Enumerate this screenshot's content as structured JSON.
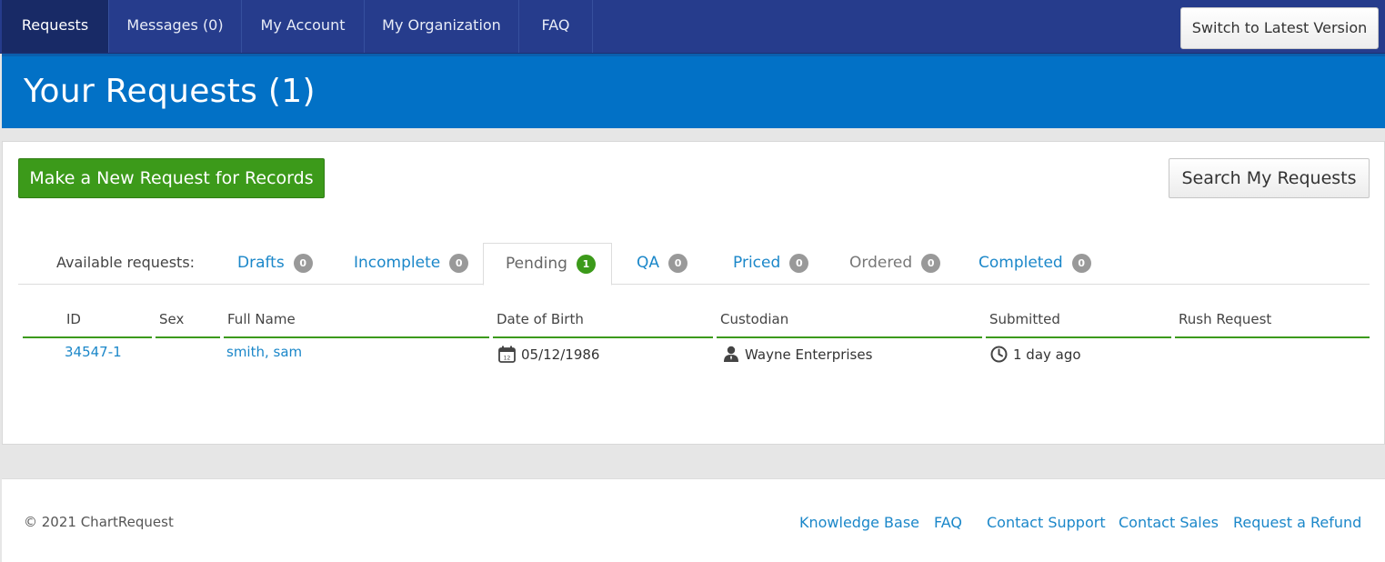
{
  "nav": {
    "items": [
      {
        "label": "Requests"
      },
      {
        "label": "Messages (0)"
      },
      {
        "label": "My Account"
      },
      {
        "label": "My Organization"
      },
      {
        "label": "FAQ"
      }
    ],
    "switch_label": "Switch to Latest Version"
  },
  "banner": {
    "title": "Your Requests (1)"
  },
  "actions": {
    "new_request": "Make a New Request for Records",
    "search": "Search My Requests"
  },
  "tabs": {
    "label": "Available requests:",
    "items": [
      {
        "label": "Drafts",
        "count": "0"
      },
      {
        "label": "Incomplete",
        "count": "0"
      },
      {
        "label": "Pending",
        "count": "1"
      },
      {
        "label": "QA",
        "count": "0"
      },
      {
        "label": "Priced",
        "count": "0"
      },
      {
        "label": "Ordered",
        "count": "0"
      },
      {
        "label": "Completed",
        "count": "0"
      }
    ]
  },
  "table": {
    "headers": [
      "ID",
      "Sex",
      "Full Name",
      "Date of Birth",
      "Custodian",
      "Submitted",
      "Rush Request"
    ],
    "rows": [
      {
        "id": "34547-1",
        "sex": "",
        "full_name": "smith, sam",
        "dob": "05/12/1986",
        "custodian": "Wayne Enterprises",
        "submitted": "1 day ago",
        "rush": ""
      }
    ]
  },
  "footer": {
    "copyright": "© 2021 ChartRequest",
    "links": [
      "Knowledge Base",
      "FAQ",
      "Contact Support",
      "Contact Sales",
      "Request a Refund"
    ]
  },
  "colors": {
    "nav": "#263c8c",
    "banner": "#0271c6",
    "accent_green": "#3c9a1a",
    "link": "#1b87c9"
  }
}
